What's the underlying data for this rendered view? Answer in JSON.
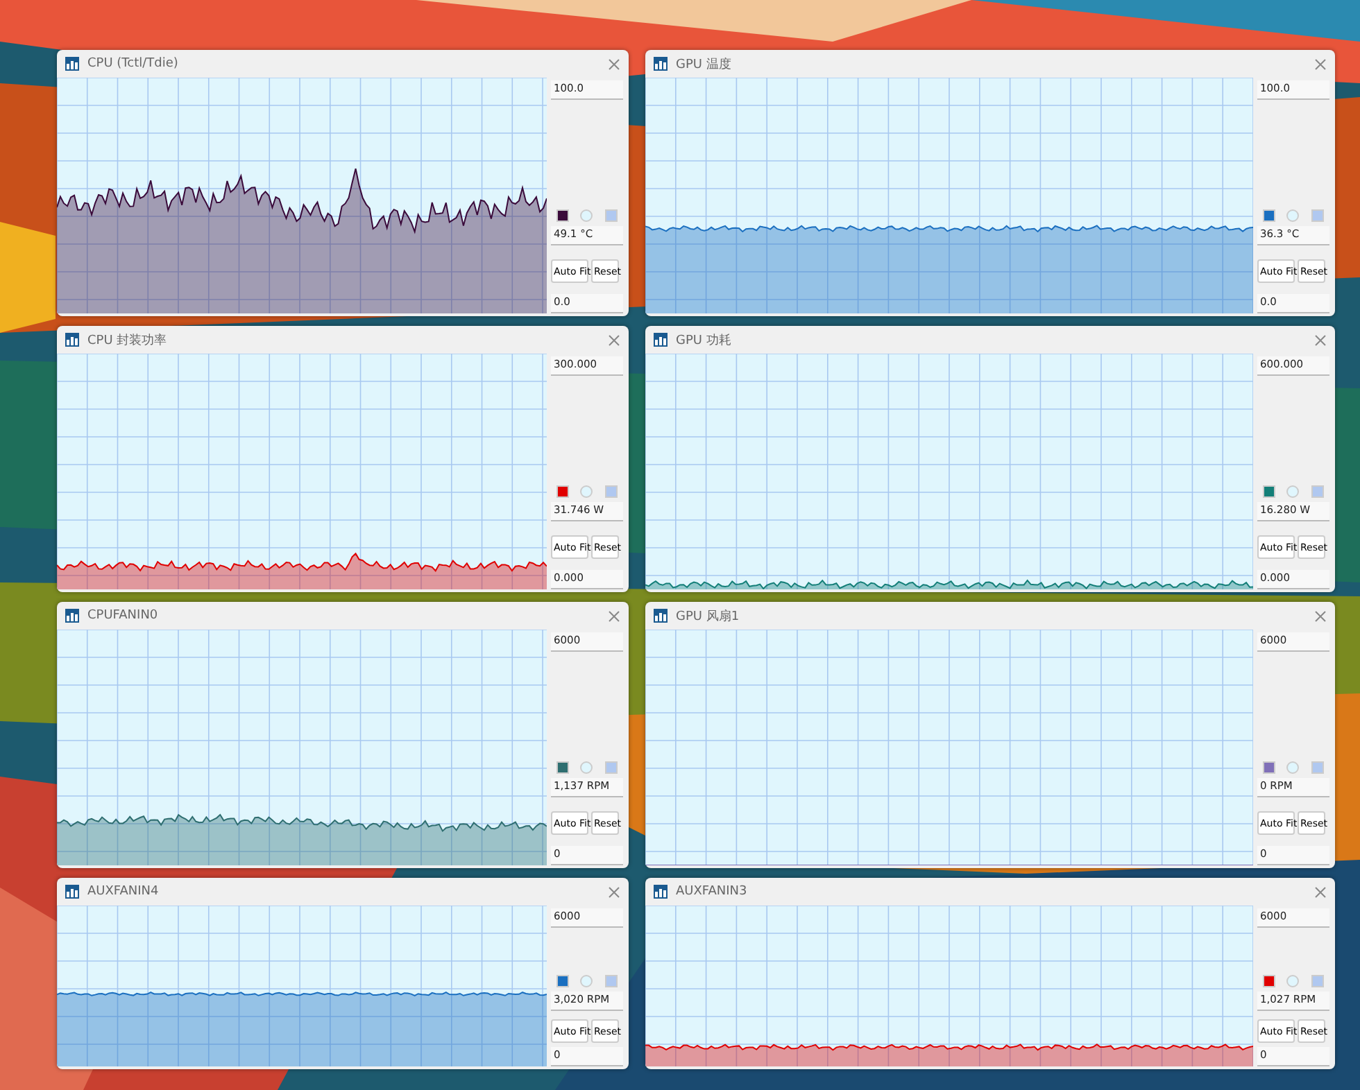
{
  "windows": [
    {
      "title": "CPU (Tctl/Tdie)",
      "max": "100.0",
      "min": "0.0",
      "reading": "49.1 °C",
      "color": "#3a0a3a",
      "buttons": [
        "Auto Fit",
        "Reset"
      ]
    },
    {
      "title": "GPU 温度",
      "max": "100.0",
      "min": "0.0",
      "reading": "36.3 °C",
      "color": "#1a6fc0",
      "buttons": [
        "Auto Fit",
        "Reset"
      ]
    },
    {
      "title": "CPU 封装功率",
      "max": "300.000",
      "min": "0.000",
      "reading": "31.746 W",
      "color": "#e00000",
      "buttons": [
        "Auto Fit",
        "Reset"
      ]
    },
    {
      "title": "GPU 功耗",
      "max": "600.000",
      "min": "0.000",
      "reading": "16.280 W",
      "color": "#137f78",
      "buttons": [
        "Auto Fit",
        "Reset"
      ]
    },
    {
      "title": "CPUFANIN0",
      "max": "6000",
      "min": "0",
      "reading": "1,137 RPM",
      "color": "#2e6e70",
      "buttons": [
        "Auto Fit",
        "Reset"
      ]
    },
    {
      "title": "GPU 风扇1",
      "max": "6000",
      "min": "0",
      "reading": "0 RPM",
      "color": "#8070b8",
      "buttons": [
        "Auto Fit",
        "Reset"
      ]
    },
    {
      "title": "AUXFANIN4",
      "max": "6000",
      "min": "0",
      "reading": "3,020 RPM",
      "color": "#1a6fc0",
      "buttons": [
        "Auto Fit",
        "Reset"
      ]
    },
    {
      "title": "AUXFANIN3",
      "max": "6000",
      "min": "0",
      "reading": "1,027 RPM",
      "color": "#e00000",
      "buttons": [
        "Auto Fit",
        "Reset"
      ]
    }
  ]
}
